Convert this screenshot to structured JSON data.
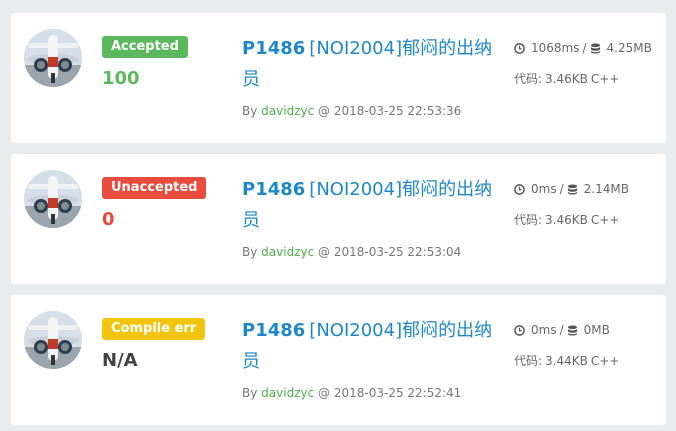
{
  "records": [
    {
      "status": "Accepted",
      "status_color": "#5cb85c",
      "score": "100",
      "score_color": "#5cb85c",
      "problem_id": "P1486",
      "problem_name": "[NOI2004]郁闷的出纳员",
      "by_label": "By",
      "user": "davidzyc",
      "at_sep": "@",
      "time": "2018-03-25 22:53:36",
      "runtime": "1068ms",
      "memory": "4.25MB",
      "code_label": "代码:",
      "code_size": "3.46KB",
      "language": "C++"
    },
    {
      "status": "Unaccepted",
      "status_color": "#e74c3c",
      "score": "0",
      "score_color": "#e74c3c",
      "problem_id": "P1486",
      "problem_name": "[NOI2004]郁闷的出纳员",
      "by_label": "By",
      "user": "davidzyc",
      "at_sep": "@",
      "time": "2018-03-25 22:53:04",
      "runtime": "0ms",
      "memory": "2.14MB",
      "code_label": "代码:",
      "code_size": "3.46KB",
      "language": "C++"
    },
    {
      "status": "Compile err",
      "status_color": "#f1c40f",
      "score": "N/A",
      "score_color": "#444444",
      "problem_id": "P1486",
      "problem_name": "[NOI2004]郁闷的出纳员",
      "by_label": "By",
      "user": "davidzyc",
      "at_sep": "@",
      "time": "2018-03-25 22:52:41",
      "runtime": "0ms",
      "memory": "0MB",
      "code_label": "代码:",
      "code_size": "3.44KB",
      "language": "C++"
    }
  ],
  "icons": {
    "time": "clock-icon",
    "memory": "database-icon",
    "avatar": "airplane-avatar"
  }
}
